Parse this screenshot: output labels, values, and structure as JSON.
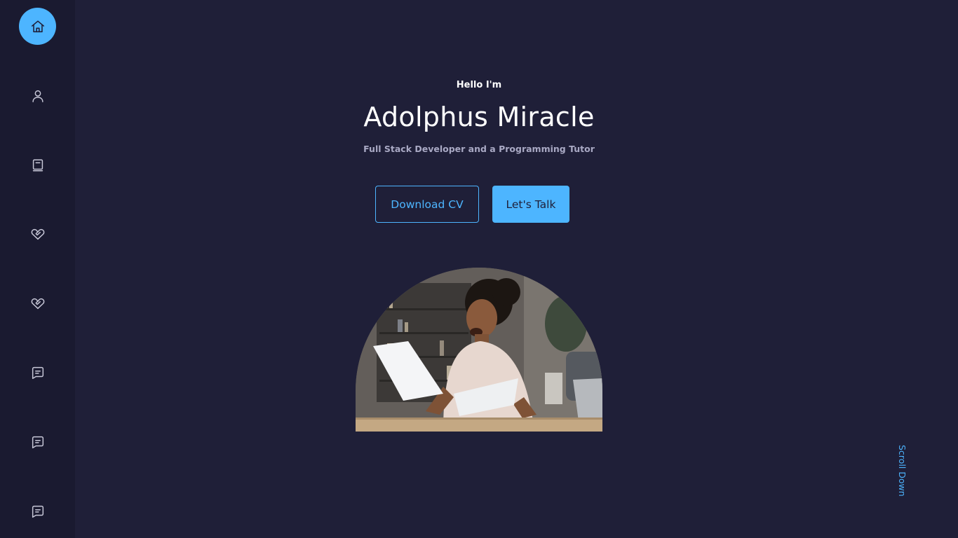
{
  "intro": {
    "greeting": "Hello I'm",
    "name": "Adolphus Miracle",
    "tagline": "Full Stack Developer and a Programming Tutor"
  },
  "actions": {
    "download_cv_label": "Download CV",
    "lets_talk_label": "Let's Talk"
  },
  "scroll": {
    "label": "Scroll Down"
  },
  "sidebar": {
    "items": [
      {
        "icon": "home-icon",
        "active": true
      },
      {
        "icon": "user-icon",
        "active": false
      },
      {
        "icon": "book-icon",
        "active": false
      },
      {
        "icon": "heart-handshake-icon",
        "active": false
      },
      {
        "icon": "heart-handshake-icon",
        "active": false
      },
      {
        "icon": "message-icon",
        "active": false
      },
      {
        "icon": "message-icon",
        "active": false
      },
      {
        "icon": "message-icon",
        "active": false
      }
    ]
  },
  "colors": {
    "background": "#1f1f38",
    "sidebar": "#1a1a30",
    "accent": "#4db5ff",
    "text": "#ffffff",
    "muted_text": "#a9a9c4"
  }
}
